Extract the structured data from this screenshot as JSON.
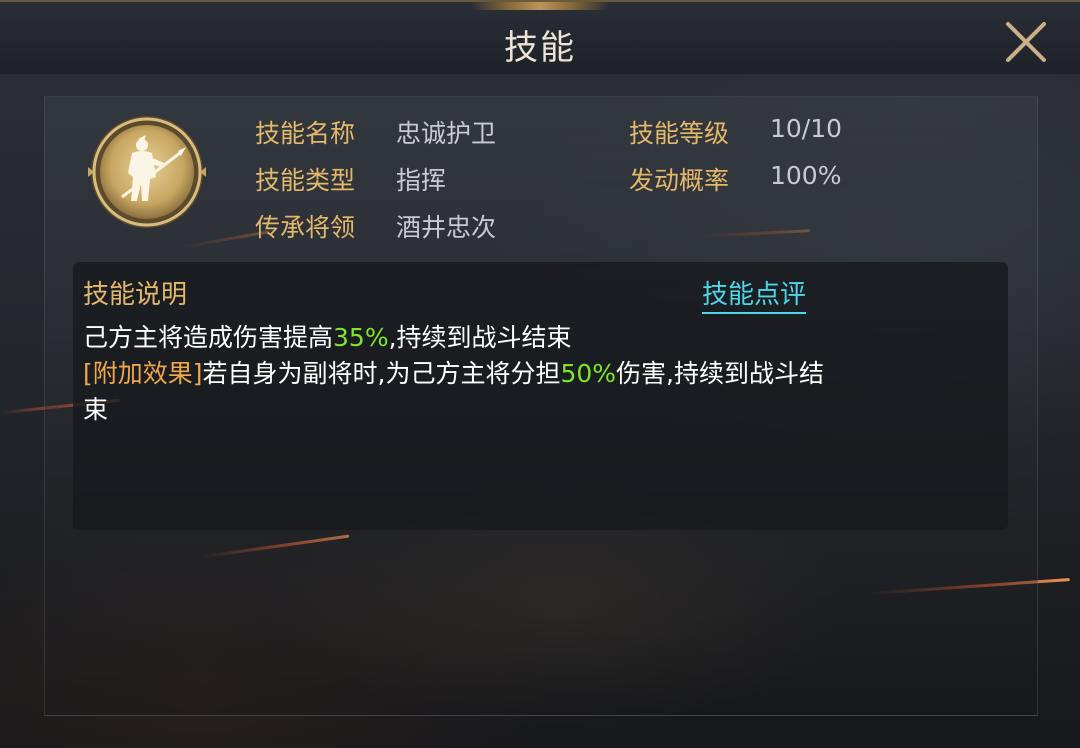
{
  "header": {
    "title": "技能"
  },
  "skill": {
    "name_label": "技能名称",
    "name_value": "忠诚护卫",
    "type_label": "技能类型",
    "type_value": "指挥",
    "inherit_label": "传承将领",
    "inherit_value": "酒井忠次",
    "level_label": "技能等级",
    "level_value": "10/10",
    "rate_label": "发动概率",
    "rate_value": "100%"
  },
  "description": {
    "title": "技能说明",
    "review_link": "技能点评",
    "line1_a": "己方主将造成伤害提高",
    "line1_pct": "35%",
    "line1_b": ",持续到战斗结束",
    "line2_tag": "[附加效果]",
    "line2_a": "若自身为副将时,为己方主将分担",
    "line2_pct": "50%",
    "line2_b": "伤害,持续到战斗结",
    "line3": "束"
  },
  "colors": {
    "label_gold": "#e3b86a",
    "value_gray": "#c8cbd1",
    "highlight_green": "#7ee62a",
    "tag_orange": "#f0a64a",
    "link_cyan": "#4fd6e6"
  },
  "icons": {
    "close": "close-x-icon",
    "emblem": "warrior-spear-emblem-icon"
  }
}
